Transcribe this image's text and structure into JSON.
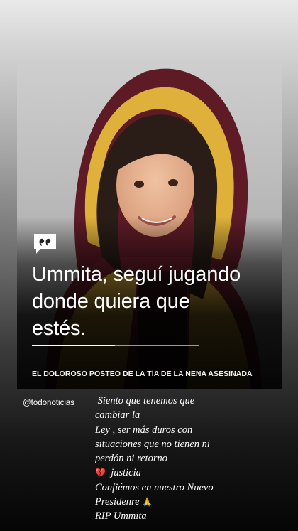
{
  "post": {
    "photo": {
      "description_icon": "child-photo",
      "colors": {
        "hood_yellow": "#e0b13a",
        "jacket_maroon": "#6b1f2a",
        "hair": "#2a1d17",
        "skin": "#e3ad8c"
      }
    },
    "quote_icon": "quote-icon",
    "quote_lines": [
      "Ummita, seguí jugando",
      "donde quiera que",
      "estés."
    ],
    "caption": "EL DOLOROSO POSTEO DE LA TÍA DE LA NENA ASESINADA"
  },
  "story": {
    "mention": "@todonoticias",
    "lines": [
      "Siento que tenemos que",
      "cambiar la",
      "Ley , ser más duros con",
      "situaciones que no tienen ni",
      "perdón ni retorno",
      "justicia",
      "Confiémos en nuestro Nuevo",
      "Presidenre",
      "RIP Ummita"
    ],
    "emojis": {
      "broken_heart": "💔",
      "folded_hands": "🙏"
    }
  }
}
